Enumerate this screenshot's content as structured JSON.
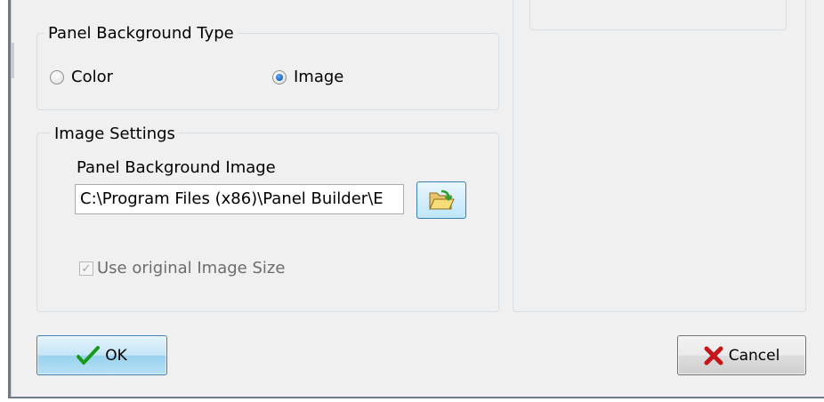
{
  "background_group": {
    "title": "Panel Background Type",
    "options": [
      {
        "label": "Color",
        "selected": false
      },
      {
        "label": "Image",
        "selected": true
      }
    ]
  },
  "image_group": {
    "title": "Image Settings",
    "field_label": "Panel Background Image",
    "path_value": "C:\\Program Files (x86)\\Panel Builder\\E",
    "use_original_size_label": "Use original Image Size",
    "use_original_size_checked": true,
    "use_original_size_enabled": false
  },
  "buttons": {
    "ok_label": "OK",
    "cancel_label": "Cancel"
  },
  "icons": {
    "browse": "folder-open-icon",
    "ok": "checkmark-icon",
    "cancel": "red-x-icon"
  },
  "colors": {
    "ok_check": "#1a9a1a",
    "cancel_x": "#c4161c",
    "radio_dot": "#1b5fb7"
  }
}
